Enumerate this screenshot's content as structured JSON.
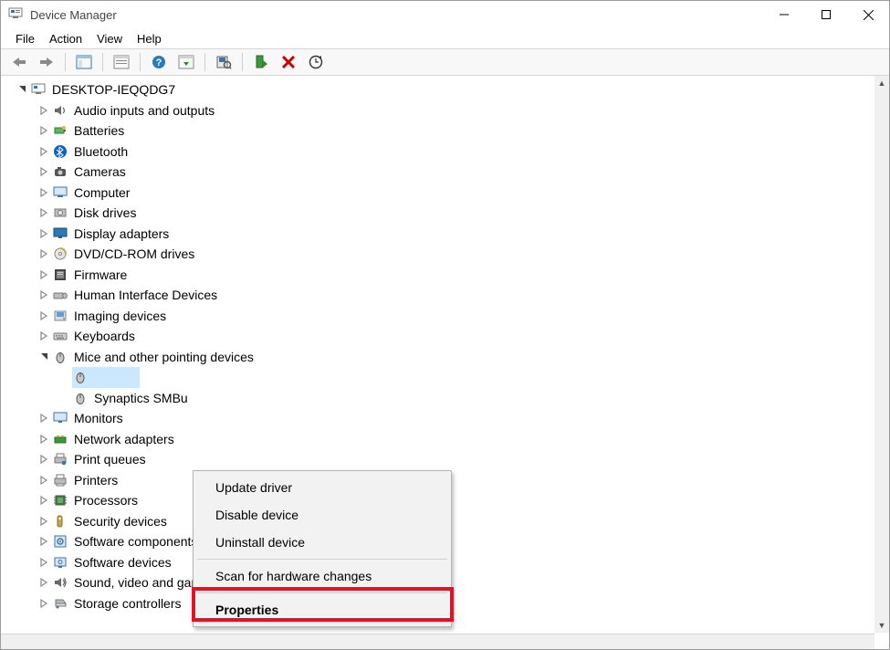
{
  "window": {
    "title": "Device Manager"
  },
  "menubar": [
    "File",
    "Action",
    "View",
    "Help"
  ],
  "tree": {
    "root": "DESKTOP-IEQQDG7",
    "items": [
      {
        "label": "Audio inputs and outputs",
        "icon": "audio"
      },
      {
        "label": "Batteries",
        "icon": "battery"
      },
      {
        "label": "Bluetooth",
        "icon": "bluetooth"
      },
      {
        "label": "Cameras",
        "icon": "camera"
      },
      {
        "label": "Computer",
        "icon": "computer"
      },
      {
        "label": "Disk drives",
        "icon": "disk"
      },
      {
        "label": "Display adapters",
        "icon": "display"
      },
      {
        "label": "DVD/CD-ROM drives",
        "icon": "dvd"
      },
      {
        "label": "Firmware",
        "icon": "firmware"
      },
      {
        "label": "Human Interface Devices",
        "icon": "hid"
      },
      {
        "label": "Imaging devices",
        "icon": "imaging"
      },
      {
        "label": "Keyboards",
        "icon": "keyboard"
      },
      {
        "label": "Mice and other pointing devices",
        "icon": "mouse",
        "expanded": true,
        "children": [
          {
            "label": "",
            "icon": "mouse",
            "selected": true
          },
          {
            "label": "Synaptics SMBu",
            "icon": "mouse"
          }
        ]
      },
      {
        "label": "Monitors",
        "icon": "monitor"
      },
      {
        "label": "Network adapters",
        "icon": "network"
      },
      {
        "label": "Print queues",
        "icon": "printqueue"
      },
      {
        "label": "Printers",
        "icon": "printer"
      },
      {
        "label": "Processors",
        "icon": "processor"
      },
      {
        "label": "Security devices",
        "icon": "security"
      },
      {
        "label": "Software components",
        "icon": "swcomp"
      },
      {
        "label": "Software devices",
        "icon": "swdev"
      },
      {
        "label": "Sound, video and game controllers",
        "icon": "sound"
      },
      {
        "label": "Storage controllers",
        "icon": "storage"
      }
    ]
  },
  "context_menu": {
    "items": [
      {
        "label": "Update driver"
      },
      {
        "label": "Disable device"
      },
      {
        "label": "Uninstall device"
      },
      {
        "sep": true
      },
      {
        "label": "Scan for hardware changes"
      },
      {
        "sep": true
      },
      {
        "label": "Properties",
        "highlighted": true
      }
    ]
  }
}
